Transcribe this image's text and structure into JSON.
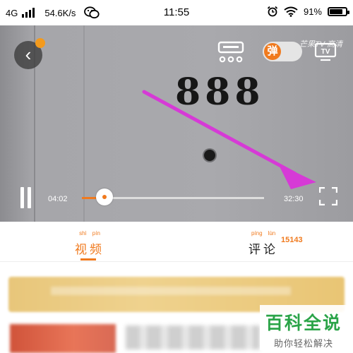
{
  "status_bar": {
    "network_type": "4G",
    "signal_icon": "signal-bars-icon",
    "net_speed": "54.6K/s",
    "app_icon": "wechat-icon",
    "time": "11:55",
    "alarm_icon": "alarm-clock-icon",
    "wifi_icon": "wifi-icon",
    "battery_percent": "91%",
    "battery_level": 0.91
  },
  "player": {
    "door_number": "888",
    "watermark": "芒果TV 高清",
    "back_icon": "back-arrow-icon",
    "top_controls": [
      "danmaku-settings-icon",
      "danmaku-toggle",
      "cast-tv-icon"
    ],
    "danmaku_label": "弹",
    "cast_label": "TV",
    "current_time": "04:02",
    "total_time": "32:30",
    "progress": 0.124,
    "fullscreen_icon": "fullscreen-icon",
    "annotation_arrow_color": "#d63ad6",
    "accent_color": "#f07a1e"
  },
  "tabs": [
    {
      "label": "视频",
      "pinyin": [
        "shì",
        "pín"
      ],
      "active": true
    },
    {
      "label": "评论",
      "pinyin": [
        "píng",
        "lùn"
      ],
      "count": "15143",
      "active": false
    }
  ],
  "brand_watermark": {
    "main": "百科全说",
    "sub": "助你轻松解决"
  }
}
